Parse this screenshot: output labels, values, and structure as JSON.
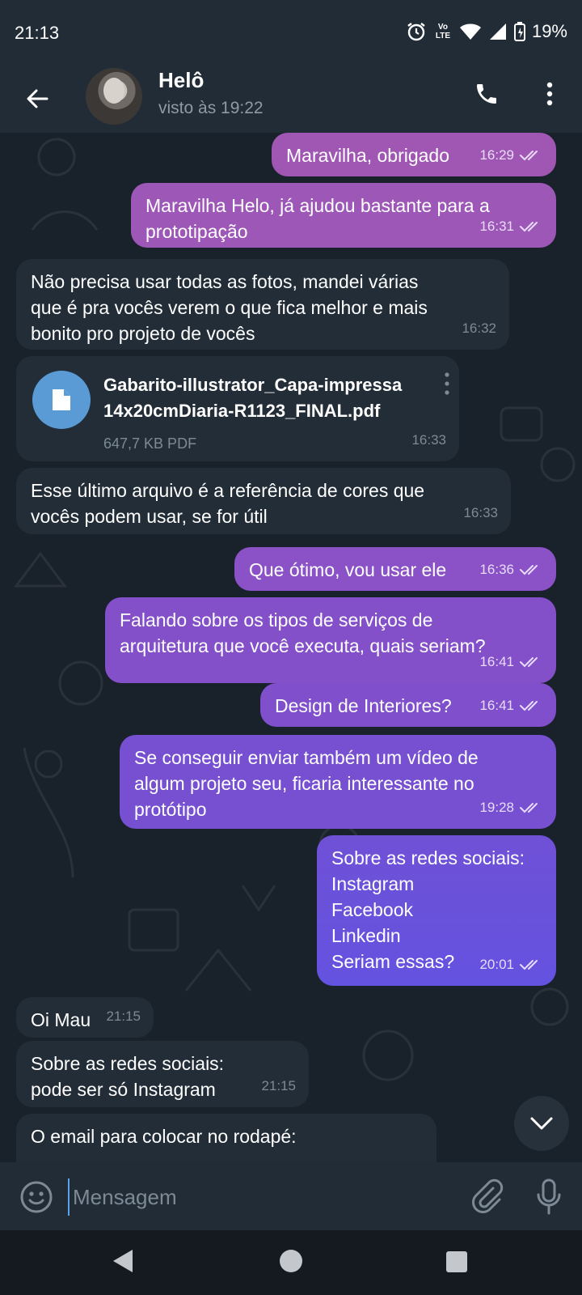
{
  "status_bar": {
    "time": "21:13",
    "network": "Vo LTE",
    "battery": "19%"
  },
  "header": {
    "contact_name": "Helô",
    "contact_status": "visto às 19:22"
  },
  "messages": [
    {
      "direction": "out",
      "text": "Maravilha, obrigado",
      "time": "16:29"
    },
    {
      "direction": "out",
      "text": "Maravilha Helo, já ajudou bastante para a\nprototipação",
      "time": "16:31"
    },
    {
      "direction": "in",
      "text": "Não precisa usar todas as fotos, mandei várias\nque é pra vocês verem o que fica melhor e mais\nbonito pro projeto de vocês",
      "time": "16:32"
    },
    {
      "direction": "in",
      "type": "file",
      "file_name": "Gabarito-illustrator_Capa-impressa\n14x20cmDiaria-R1123_FINAL.pdf",
      "file_size": "647,7 KB PDF",
      "time": "16:33"
    },
    {
      "direction": "in",
      "text": "Esse último arquivo é a referência de cores que\nvocês podem usar, se for útil",
      "time": "16:33"
    },
    {
      "direction": "out",
      "text": "Que ótimo, vou usar ele",
      "time": "16:36"
    },
    {
      "direction": "out",
      "text": "Falando sobre os tipos de serviços de\narquitetura que você executa, quais seriam?",
      "time": "16:41"
    },
    {
      "direction": "out",
      "text": "Design de Interiores?",
      "time": "16:41"
    },
    {
      "direction": "out",
      "text": "Se conseguir enviar também um vídeo de\nalgum projeto seu, ficaria interessante no\nprotótipo",
      "time": "19:28"
    },
    {
      "direction": "out",
      "text": "Sobre as redes sociais:\nInstagram\nFacebook\nLinkedin\nSeriam essas?",
      "time": "20:01"
    },
    {
      "direction": "in",
      "text": "Oi Mau",
      "time": "21:15"
    },
    {
      "direction": "in",
      "text": "Sobre as redes sociais:\npode ser só Instagram",
      "time": "21:15"
    },
    {
      "direction": "in",
      "text": "O email para colocar no rodapé:",
      "time": ""
    }
  ],
  "composer": {
    "placeholder": "Mensagem",
    "value": ""
  },
  "colors": {
    "background": "#19212a",
    "incoming_bubble": "#222d37",
    "outgoing_top": "#9b55b8",
    "outgoing_bottom": "#6452e0",
    "header": "#212c36",
    "accent": "#5a9bd6"
  },
  "icons": {
    "back": "arrow-left-icon",
    "call": "phone-icon",
    "menu": "more-vertical-icon",
    "file": "document-icon",
    "scroll_down": "chevron-down-icon",
    "emoji": "smiley-icon",
    "attach": "paperclip-icon",
    "mic": "microphone-icon"
  }
}
